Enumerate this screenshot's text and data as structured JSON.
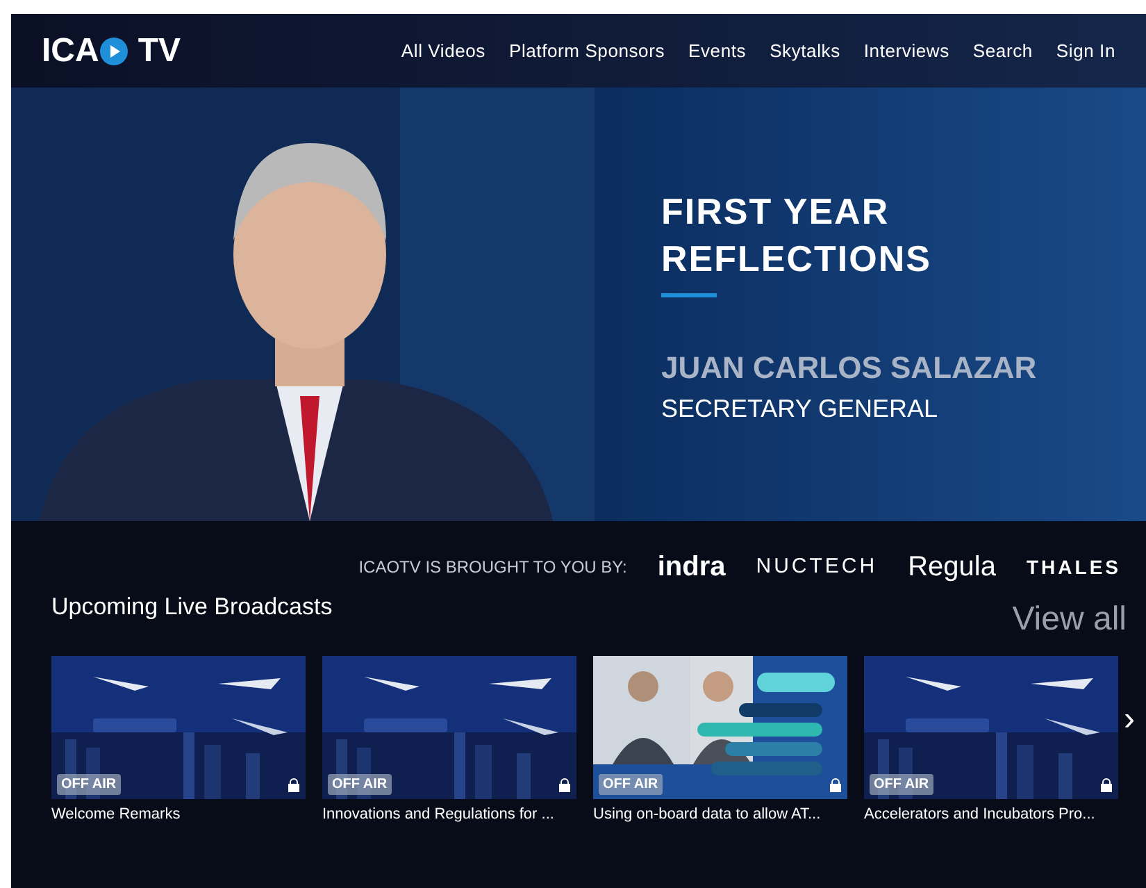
{
  "header": {
    "logo_left": "ICA",
    "logo_right": "TV",
    "nav": [
      "All Videos",
      "Platform Sponsors",
      "Events",
      "Skytalks",
      "Interviews",
      "Search",
      "Sign In"
    ]
  },
  "hero": {
    "title_lines": [
      "FIRST YEAR",
      "REFLECTIONS"
    ],
    "name": "JUAN CARLOS SALAZAR",
    "role": "SECRETARY GENERAL"
  },
  "sponsors": {
    "label": "ICAOTV IS BROUGHT TO YOU BY:",
    "logos": [
      "indra",
      "NUCTECH",
      "Regula",
      "THALES"
    ]
  },
  "broadcasts": {
    "title": "Upcoming Live Broadcasts",
    "view_all": "View all",
    "next": "›",
    "items": [
      {
        "title": "Welcome Remarks",
        "badge": "OFF AIR",
        "kind": "event",
        "locked": true
      },
      {
        "title": "Innovations and Regulations for ...",
        "badge": "OFF AIR",
        "kind": "event",
        "locked": true
      },
      {
        "title": "Using on-board data to allow AT...",
        "badge": "OFF AIR",
        "kind": "talk",
        "locked": true
      },
      {
        "title": "Accelerators and Incubators Pro...",
        "badge": "OFF AIR",
        "kind": "event",
        "locked": true
      }
    ]
  }
}
